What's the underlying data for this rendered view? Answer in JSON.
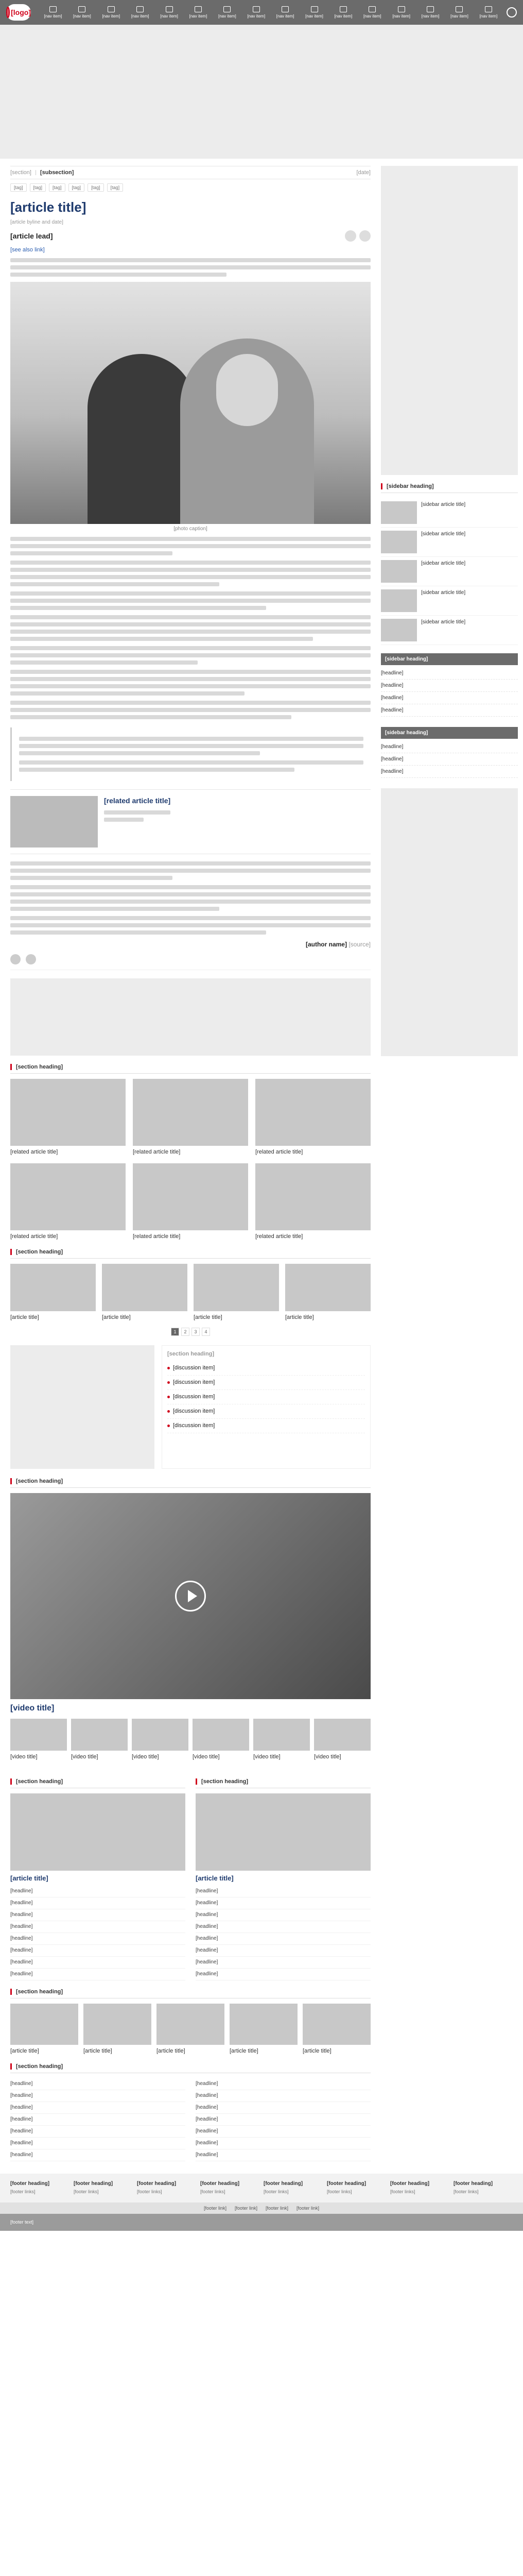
{
  "header": {
    "logo_text": "[logo]",
    "nav": [
      "[nav item]",
      "[nav item]",
      "[nav item]",
      "[nav item]",
      "[nav item]",
      "[nav item]",
      "[nav item]",
      "[nav item]",
      "[nav item]",
      "[nav item]",
      "[nav item]",
      "[nav item]",
      "[nav item]",
      "[nav item]",
      "[nav item]",
      "[nav item]"
    ]
  },
  "breadcrumb": {
    "section": "[section]",
    "subsection": "[subsection]",
    "date": "[date]"
  },
  "tags": [
    "[tag]",
    "[tag]",
    "[tag]",
    "[tag]",
    "[tag]",
    "[tag]"
  ],
  "article": {
    "title": "[article title]",
    "meta": "[article byline and date]",
    "sapo": "[article lead]",
    "see_also": "[see also link]",
    "caption": "[photo caption]",
    "related_title": "[related article title]",
    "author": "[author name]",
    "author_source": "[source]"
  },
  "related_section": "[section heading]",
  "related_cards": [
    {
      "title": "[related article title]"
    },
    {
      "title": "[related article title]"
    },
    {
      "title": "[related article title]"
    },
    {
      "title": "[related article title]"
    },
    {
      "title": "[related article title]"
    },
    {
      "title": "[related article title]"
    }
  ],
  "four_section": "[section heading]",
  "four_cards": [
    {
      "title": "[article title]"
    },
    {
      "title": "[article title]"
    },
    {
      "title": "[article title]"
    },
    {
      "title": "[article title]"
    }
  ],
  "pager": [
    "1",
    "2",
    "3",
    "4"
  ],
  "discuss": {
    "title": "[section heading]",
    "items": [
      "[discussion item]",
      "[discussion item]",
      "[discussion item]",
      "[discussion item]",
      "[discussion item]"
    ]
  },
  "video": {
    "section": "[section heading]",
    "title": "[video title]",
    "thumbs": [
      "[video title]",
      "[video title]",
      "[video title]",
      "[video title]",
      "[video title]",
      "[video title]"
    ]
  },
  "left_col": {
    "section": "[section heading]",
    "headline": "[article title]",
    "items": [
      "[headline]",
      "[headline]",
      "[headline]",
      "[headline]",
      "[headline]",
      "[headline]",
      "[headline]",
      "[headline]"
    ]
  },
  "right_col": {
    "section": "[section heading]",
    "headline": "[article title]",
    "items": [
      "[headline]",
      "[headline]",
      "[headline]",
      "[headline]",
      "[headline]",
      "[headline]",
      "[headline]",
      "[headline]"
    ]
  },
  "five_section": "[section heading]",
  "five_cards": [
    {
      "title": "[article title]"
    },
    {
      "title": "[article title]"
    },
    {
      "title": "[article title]"
    },
    {
      "title": "[article title]"
    },
    {
      "title": "[article title]"
    }
  ],
  "bottom_section": "[section heading]",
  "bottom_left": [
    "[headline]",
    "[headline]",
    "[headline]",
    "[headline]",
    "[headline]",
    "[headline]",
    "[headline]"
  ],
  "bottom_right": [
    "[headline]",
    "[headline]",
    "[headline]",
    "[headline]",
    "[headline]",
    "[headline]",
    "[headline]"
  ],
  "sidebar": {
    "block1_title": "[sidebar heading]",
    "block1": [
      {
        "title": "[sidebar article title]"
      },
      {
        "title": "[sidebar article title]"
      },
      {
        "title": "[sidebar article title]"
      },
      {
        "title": "[sidebar article title]"
      },
      {
        "title": "[sidebar article title]"
      }
    ],
    "block2_title": "[sidebar heading]",
    "block2": [
      "[headline]",
      "[headline]",
      "[headline]",
      "[headline]"
    ],
    "block3_title": "[sidebar heading]",
    "block3": [
      "[headline]",
      "[headline]",
      "[headline]"
    ]
  },
  "footer": {
    "cols": [
      {
        "h": "[footer heading]",
        "p": "[footer links]"
      },
      {
        "h": "[footer heading]",
        "p": "[footer links]"
      },
      {
        "h": "[footer heading]",
        "p": "[footer links]"
      },
      {
        "h": "[footer heading]",
        "p": "[footer links]"
      },
      {
        "h": "[footer heading]",
        "p": "[footer links]"
      },
      {
        "h": "[footer heading]",
        "p": "[footer links]"
      },
      {
        "h": "[footer heading]",
        "p": "[footer links]"
      },
      {
        "h": "[footer heading]",
        "p": "[footer links]"
      }
    ],
    "bar": [
      "[footer link]",
      "[footer link]",
      "[footer link]",
      "[footer link]"
    ],
    "info": "[footer text]"
  },
  "colors": {
    "brand": "#d0021b",
    "title": "#1f3b6e",
    "header_bg": "#6b6b6b"
  }
}
